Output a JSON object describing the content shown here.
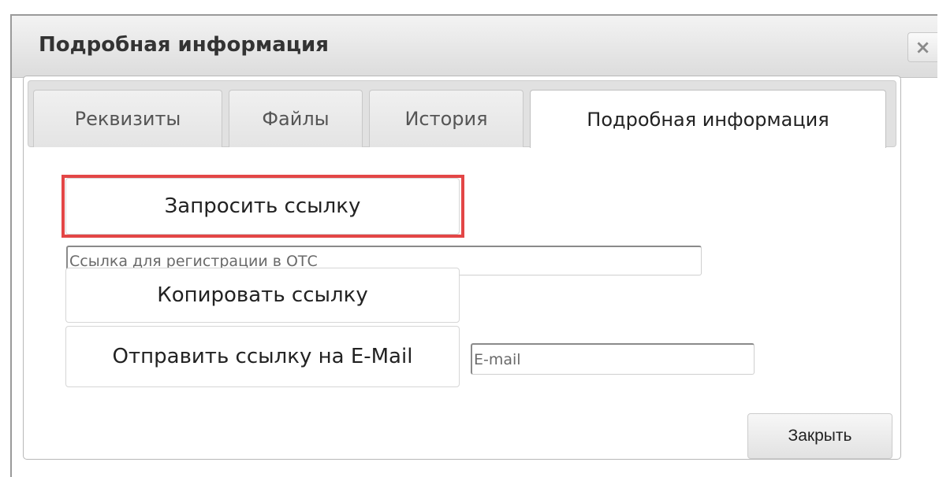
{
  "dialog": {
    "title": "Подробная информация",
    "close_icon": "×"
  },
  "tabs": [
    {
      "label": "Реквизиты",
      "active": false
    },
    {
      "label": "Файлы",
      "active": false
    },
    {
      "label": "История",
      "active": false
    },
    {
      "label": "Подробная информация",
      "active": true
    }
  ],
  "actions": {
    "request_link_label": "Запросить ссылку",
    "link_field_placeholder": "Ссылка для регистрации в ОТС",
    "copy_link_label": "Копировать ссылку",
    "send_email_label": "Отправить ссылку на E-Mail",
    "email_field_placeholder": "E-mail",
    "close_label": "Закрыть"
  },
  "colors": {
    "highlight": "#e34646"
  }
}
